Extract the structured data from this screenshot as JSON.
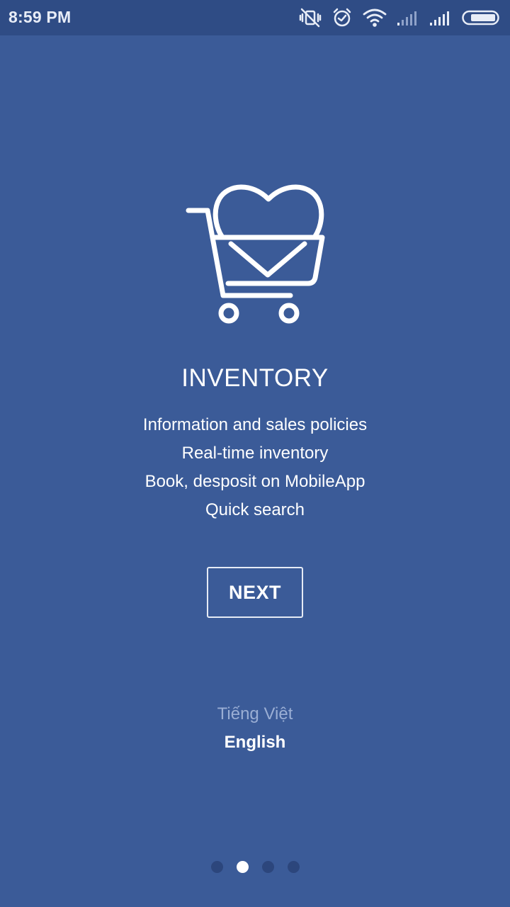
{
  "status_bar": {
    "time": "8:59 PM",
    "icons": [
      "vibrate-off-icon",
      "alarm-icon",
      "wifi-icon",
      "signal-weak-icon",
      "signal-full-icon",
      "battery-icon"
    ]
  },
  "onboarding": {
    "icon": "shopping-cart-heart-icon",
    "title": "INVENTORY",
    "features": [
      "Information and sales policies",
      "Real-time inventory",
      "Book, desposit on MobileApp",
      "Quick search"
    ],
    "next_label": "NEXT"
  },
  "language": {
    "vietnamese": "Tiếng Việt",
    "english": "English",
    "selected": "English"
  },
  "pager": {
    "total": 4,
    "current": 2
  },
  "colors": {
    "background": "#3b5b98",
    "status_bar": "#2f4c85",
    "text": "#ffffff",
    "inactive_language": "#9aaed4",
    "inactive_dot": "#2c467c"
  }
}
